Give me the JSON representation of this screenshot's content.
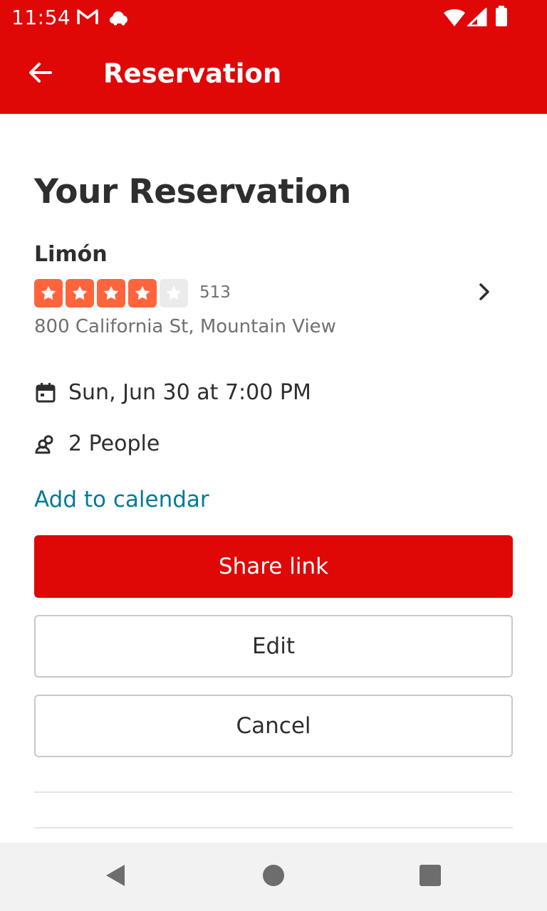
{
  "status_bar": {
    "time": "11:54",
    "icons": [
      "gmail-icon",
      "cloud-icon",
      "wifi-icon",
      "signal-icon",
      "battery-icon"
    ]
  },
  "app_bar": {
    "title": "Reservation",
    "back_icon": "arrow-back-icon"
  },
  "reservation": {
    "heading": "Your Reservation",
    "restaurant_name": "Limón",
    "rating": 4,
    "rating_max": 5,
    "review_count": "513",
    "address": "800 California St, Mountain View",
    "datetime": "Sun, Jun 30 at 7:00 PM",
    "party_size": "2 People",
    "add_to_calendar_label": "Add to calendar"
  },
  "actions": {
    "share_label": "Share link",
    "edit_label": "Edit",
    "cancel_label": "Cancel"
  },
  "colors": {
    "brand_red": "#e00707",
    "star_orange": "#ff643d",
    "link_teal": "#027a97"
  },
  "nav_bar": {
    "buttons": [
      "back-triangle-icon",
      "home-circle-icon",
      "recents-square-icon"
    ]
  }
}
